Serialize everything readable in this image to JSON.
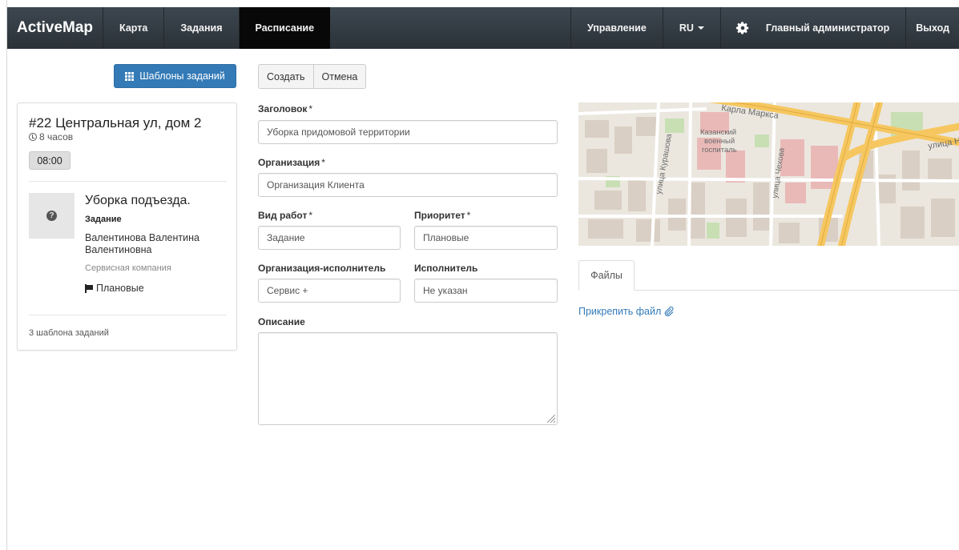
{
  "navbar": {
    "brand": "ActiveMap",
    "left_items": [
      "Карта",
      "Задания",
      "Расписание"
    ],
    "active_item": "Расписание",
    "right_items": {
      "management": "Управление",
      "language": "RU",
      "user": "Главный администратор",
      "logout": "Выход"
    },
    "icons": {
      "settings": "gear-icon",
      "language_dropdown": "caret-down-icon"
    },
    "colors": {
      "background": "#333b42",
      "active": "#080808"
    }
  },
  "sidebar": {
    "templates_button": "Шаблоны заданий",
    "templates_button_icon": "grid-icon",
    "card": {
      "title": "#22 Центральная ул, дом 2",
      "duration": "8 часов",
      "time": "08:00",
      "task": {
        "name": "Уборка подъезда.",
        "type": "Задание",
        "person": "Валентинова Валентина Валентиновна",
        "company": "Сервисная компания",
        "priority": "Плановые"
      },
      "footer": "3 шаблона заданий"
    }
  },
  "form": {
    "buttons": {
      "create": "Создать",
      "cancel": "Отмена"
    },
    "title": {
      "label": "Заголовок",
      "required": "*",
      "value": "Уборка придомовой территории"
    },
    "organization": {
      "label": "Организация",
      "required": "*",
      "value": "Организация Клиента"
    },
    "work_type": {
      "label": "Вид работ",
      "required": "*",
      "value": "Задание"
    },
    "priority": {
      "label": "Приоритет",
      "required": "*",
      "value": "Плановые"
    },
    "executor_org": {
      "label": "Организация-исполнитель",
      "value": "Сервис +"
    },
    "executor": {
      "label": "Исполнитель",
      "value": "Не указан"
    },
    "description": {
      "label": "Описание",
      "value": ""
    }
  },
  "map": {
    "labels": {
      "street_marx": "Карла Маркса",
      "street_right": "улица Н",
      "hospital_line1": "Казанский",
      "hospital_line2": "военный",
      "hospital_line3": "госпиталь",
      "street_kurashova": "улица Курашова",
      "street_chekhova": "улица Чехова"
    },
    "colors": {
      "road_major": "#f6c760",
      "building": "#d9cfc4",
      "hospital": "#e9b9b7",
      "park": "#c8dfb4"
    }
  },
  "attachments": {
    "tab": "Файлы",
    "attach_link": "Прикрепить файл",
    "attach_icon": "paperclip-icon"
  }
}
